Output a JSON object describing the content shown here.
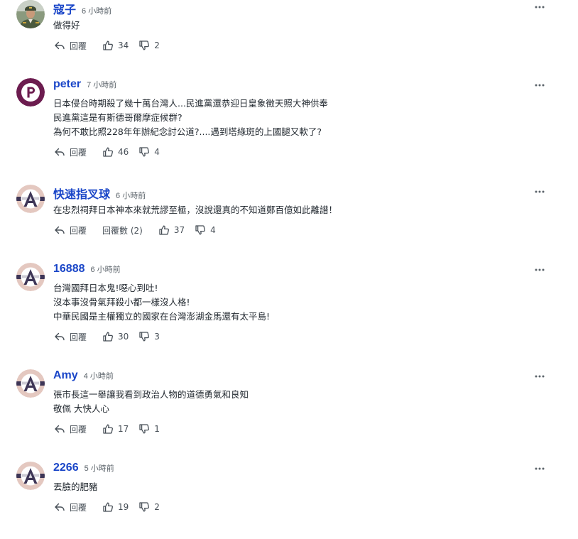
{
  "comments": [
    {
      "name": "寇子",
      "time": "6 小時前",
      "lines": [
        "做得好"
      ],
      "reply_label": "回覆",
      "likes": "34",
      "dislikes": "2",
      "avatar": "photo"
    },
    {
      "name": "peter",
      "time": "7 小時前",
      "lines": [
        "日本侵台時期殺了幾十萬台灣人...民進黨還恭迎日皇象徵天照大神供奉",
        "民進黨這是有斯德哥爾摩症候群?",
        "為何不敢比照228年年辦紀念討公道?....遇到塔綠斑的上國腿又軟了?"
      ],
      "reply_label": "回覆",
      "likes": "46",
      "dislikes": "4",
      "avatar": "letter-p"
    },
    {
      "name": "快速指叉球",
      "time": "6 小時前",
      "lines": [
        "在忠烈祠拜日本神本來就荒謬至極，沒說還真的不知道鄭百億如此離譜！"
      ],
      "reply_label": "回覆",
      "replies_label": "回覆數 (2)",
      "likes": "37",
      "dislikes": "4",
      "avatar": "letter-a"
    },
    {
      "name": "16888",
      "time": "6 小時前",
      "lines": [
        "台灣國拜日本鬼!噁心到吐!",
        "沒本事沒骨氣拜殺小都一樣沒人格!",
        "中華民國是主權獨立的國家在台灣澎湖金馬還有太平島!"
      ],
      "reply_label": "回覆",
      "likes": "30",
      "dislikes": "3",
      "avatar": "letter-a"
    },
    {
      "name": "Amy",
      "time": "4 小時前",
      "lines": [
        "張市長這一舉讓我看到政治人物的道德勇氣和良知",
        "敬佩 大快人心"
      ],
      "reply_label": "回覆",
      "likes": "17",
      "dislikes": "1",
      "avatar": "letter-a"
    },
    {
      "name": "2266",
      "time": "5 小時前",
      "lines": [
        "丟臉的肥豬"
      ],
      "reply_label": "回覆",
      "likes": "19",
      "dislikes": "2",
      "avatar": "letter-a"
    }
  ],
  "colors": {
    "name": "#1a46c8",
    "time": "#5b636a",
    "avatar_p": "#6c1c4f",
    "avatar_a_bg": "#e4c8c0",
    "avatar_a_band": "#3d3556"
  },
  "icons": [
    "reply-icon",
    "thumbs-up-icon",
    "thumbs-down-icon",
    "more-vertical-icon"
  ]
}
